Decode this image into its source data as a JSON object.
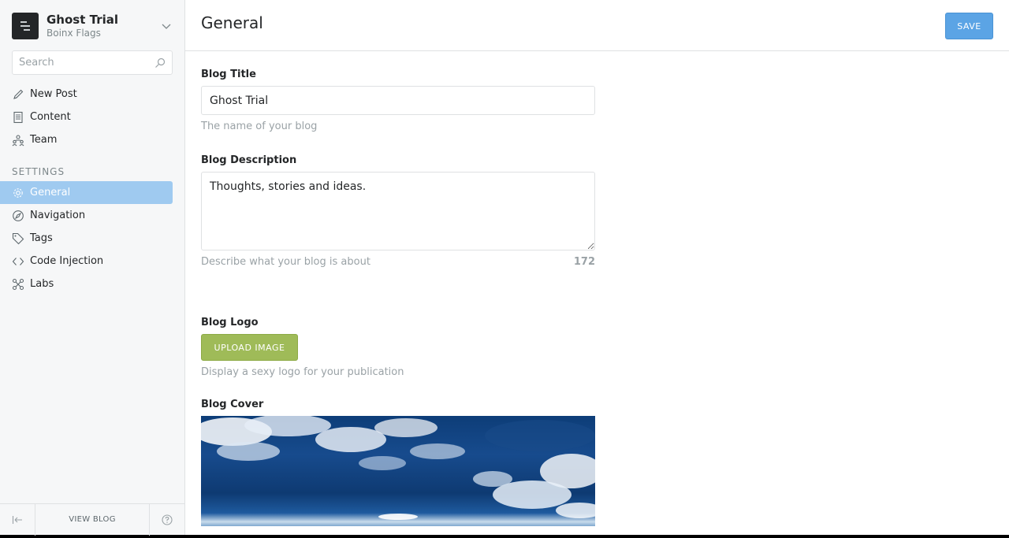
{
  "sidebar": {
    "blog_name": "Ghost Trial",
    "user_name": "Boinx Flags",
    "search_placeholder": "Search",
    "nav": [
      {
        "label": "New Post",
        "icon": "pencil-icon"
      },
      {
        "label": "Content",
        "icon": "document-icon"
      },
      {
        "label": "Team",
        "icon": "team-icon"
      }
    ],
    "settings_label": "SETTINGS",
    "settings_nav": [
      {
        "label": "General",
        "icon": "gear-icon",
        "active": true
      },
      {
        "label": "Navigation",
        "icon": "compass-icon"
      },
      {
        "label": "Tags",
        "icon": "tag-icon"
      },
      {
        "label": "Code Injection",
        "icon": "code-icon"
      },
      {
        "label": "Labs",
        "icon": "labs-icon"
      }
    ],
    "footer": {
      "view_blog": "VIEW BLOG",
      "collapse_icon": "collapse-sidebar-icon",
      "help_icon": "help-icon"
    }
  },
  "header": {
    "title": "General",
    "save_label": "SAVE"
  },
  "form": {
    "title_label": "Blog Title",
    "title_value": "Ghost Trial",
    "title_help": "The name of your blog",
    "description_label": "Blog Description",
    "description_value": "Thoughts, stories and ideas.",
    "description_help": "Describe what your blog is about",
    "description_count": "172",
    "logo_label": "Blog Logo",
    "upload_label": "UPLOAD IMAGE",
    "logo_help": "Display a sexy logo for your publication",
    "cover_label": "Blog Cover"
  },
  "colors": {
    "active_nav": "#9fcaf0",
    "save_button": "#5ba4e5",
    "upload_button": "#9fbb58"
  }
}
